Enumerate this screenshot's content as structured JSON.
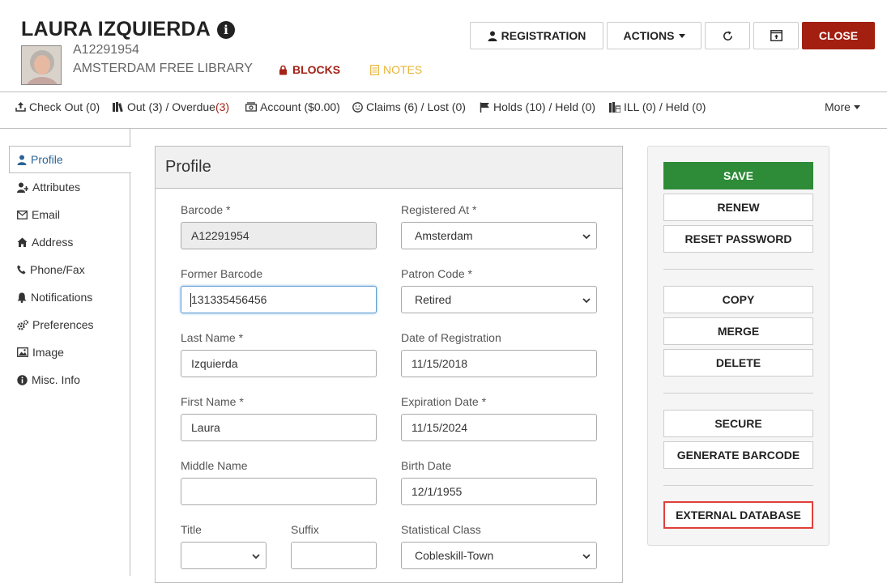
{
  "header": {
    "patron_name": "LAURA IZQUIERDA",
    "barcode": "A12291954",
    "branch": "AMSTERDAM FREE LIBRARY",
    "blocks_label": "BLOCKS",
    "notes_label": "NOTES",
    "buttons": {
      "registration": "REGISTRATION",
      "actions": "ACTIONS",
      "close": "CLOSE"
    }
  },
  "nav": {
    "checkout": "Check Out (0)",
    "out": "Out (3) / Overdue ",
    "overdue_count": "(3)",
    "account": "Account ($0.00)",
    "claims": "Claims (6) / Lost (0)",
    "holds": "Holds (10) / Held (0)",
    "ill": "ILL (0) / Held (0)",
    "more": "More"
  },
  "sidebar": {
    "items": [
      {
        "label": "Profile"
      },
      {
        "label": "Attributes"
      },
      {
        "label": "Email"
      },
      {
        "label": "Address"
      },
      {
        "label": "Phone/Fax"
      },
      {
        "label": "Notifications"
      },
      {
        "label": "Preferences"
      },
      {
        "label": "Image"
      },
      {
        "label": "Misc. Info"
      }
    ]
  },
  "profile": {
    "title": "Profile",
    "barcode_label": "Barcode *",
    "barcode_value": "A12291954",
    "registered_at_label": "Registered At *",
    "registered_at_value": "Amsterdam",
    "former_barcode_label": "Former Barcode",
    "former_barcode_value": "131335456456",
    "patron_code_label": "Patron Code *",
    "patron_code_value": "Retired",
    "last_name_label": "Last Name *",
    "last_name_value": "Izquierda",
    "date_reg_label": "Date of Registration",
    "date_reg_value": "11/15/2018",
    "first_name_label": "First Name *",
    "first_name_value": "Laura",
    "expiration_label": "Expiration Date *",
    "expiration_value": "11/15/2024",
    "middle_name_label": "Middle Name",
    "middle_name_value": "",
    "birth_date_label": "Birth Date",
    "birth_date_value": "12/1/1955",
    "title_label": "Title",
    "title_value": "",
    "suffix_label": "Suffix",
    "suffix_value": "",
    "stat_class_label": "Statistical Class",
    "stat_class_value": "Cobleskill-Town"
  },
  "actions_panel": {
    "save": "SAVE",
    "renew": "RENEW",
    "reset_password": "RESET PASSWORD",
    "copy": "COPY",
    "merge": "MERGE",
    "delete": "DELETE",
    "secure": "SECURE",
    "generate_barcode": "GENERATE BARCODE",
    "external_database": "EXTERNAL DATABASE"
  },
  "colors": {
    "close_red": "#a31f10",
    "save_green": "#2e8b38",
    "blocks_red": "#a32317",
    "notes_yellow": "#e8b437",
    "highlight_red": "#e0403a"
  }
}
